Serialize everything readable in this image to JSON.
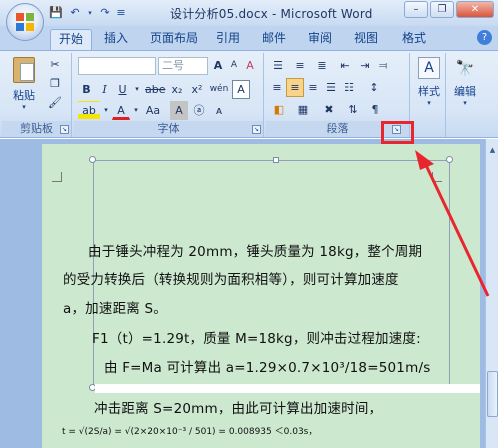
{
  "window": {
    "title": "设计分析05.docx - Microsoft Word",
    "minimize_icon": "minimize-icon",
    "maximize_icon": "restore-icon",
    "close_icon": "close-icon"
  },
  "quick_access": [
    "save-icon",
    "undo-icon",
    "redo-icon",
    "customize-icon"
  ],
  "tabs": [
    "开始",
    "插入",
    "页面布局",
    "引用",
    "邮件",
    "审阅",
    "视图",
    "格式"
  ],
  "active_tab": "开始",
  "ribbon": {
    "clipboard": {
      "label": "剪贴板",
      "paste_label": "粘贴"
    },
    "font": {
      "label": "字体",
      "font_name": "",
      "font_size": "二号",
      "bold": "B",
      "italic": "I",
      "underline": "U",
      "strike": "abe",
      "subscript": "x₂",
      "superscript": "x²",
      "highlight": "ab",
      "font_color": "A",
      "change_case": "Aa",
      "char_border": "A",
      "enclose": "A",
      "phonetic": "wén",
      "grow": "A",
      "shrink": "A",
      "clear": "A"
    },
    "paragraph": {
      "label": "段落"
    },
    "styles": {
      "label": "样式"
    },
    "editing": {
      "label": "编辑"
    }
  },
  "document": {
    "lines": [
      "由于锤头冲程为 20mm，锤头质量为 18kg，整个周期",
      "的受力转换后（转换规则为面积相等），则可计算加速度",
      "a，加速距离 S。",
      "F1（t）=1.29t，质量 M=18kg，则冲击过程加速度:",
      "由 F=Ma    可计算出 a=1.29×0.7×10³/18=501m/s",
      "冲击距离  S=20mm，由此可计算出加速时间，"
    ],
    "formula": "t = √(2S/a) = √(2×20×10⁻³ / 501) = 0.008935 ＜0.03s，"
  },
  "colors": {
    "highlight_box": "#e8262e",
    "page_background": "#cce8cf",
    "ribbon_bg": "#dbe7f6"
  }
}
